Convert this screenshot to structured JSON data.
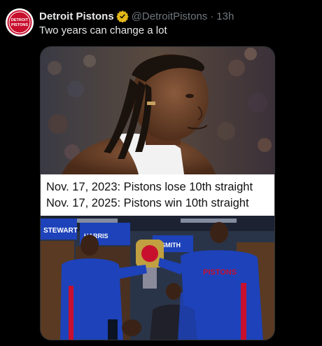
{
  "tweet": {
    "display_name": "Detroit Pistons",
    "handle": "@DetroitPistons",
    "separator": "·",
    "timestamp": "13h",
    "text": "Two years can change a lot"
  },
  "avatar": {
    "logo_text_top": "DETROIT",
    "logo_text_bottom": "PISTONS",
    "icon": "pistons-logo"
  },
  "media": {
    "caption_lines": [
      "Nov. 17, 2023: Pistons lose 10th straight",
      "Nov. 17, 2025: Pistons win 10th straight"
    ],
    "top_photo_icon": "player-portrait",
    "bottom_photo_icon": "locker-room-celebration",
    "locker_nameplates": [
      "STEWART",
      "HARRIS",
      "SMITH"
    ],
    "jersey_text": "PISTONS"
  },
  "colors": {
    "background": "#000000",
    "primary_text": "#e7e9ea",
    "secondary_text": "#71767b",
    "verified_gold": "#e2b719",
    "pistons_red": "#c8102e",
    "pistons_blue": "#1d42ba"
  }
}
